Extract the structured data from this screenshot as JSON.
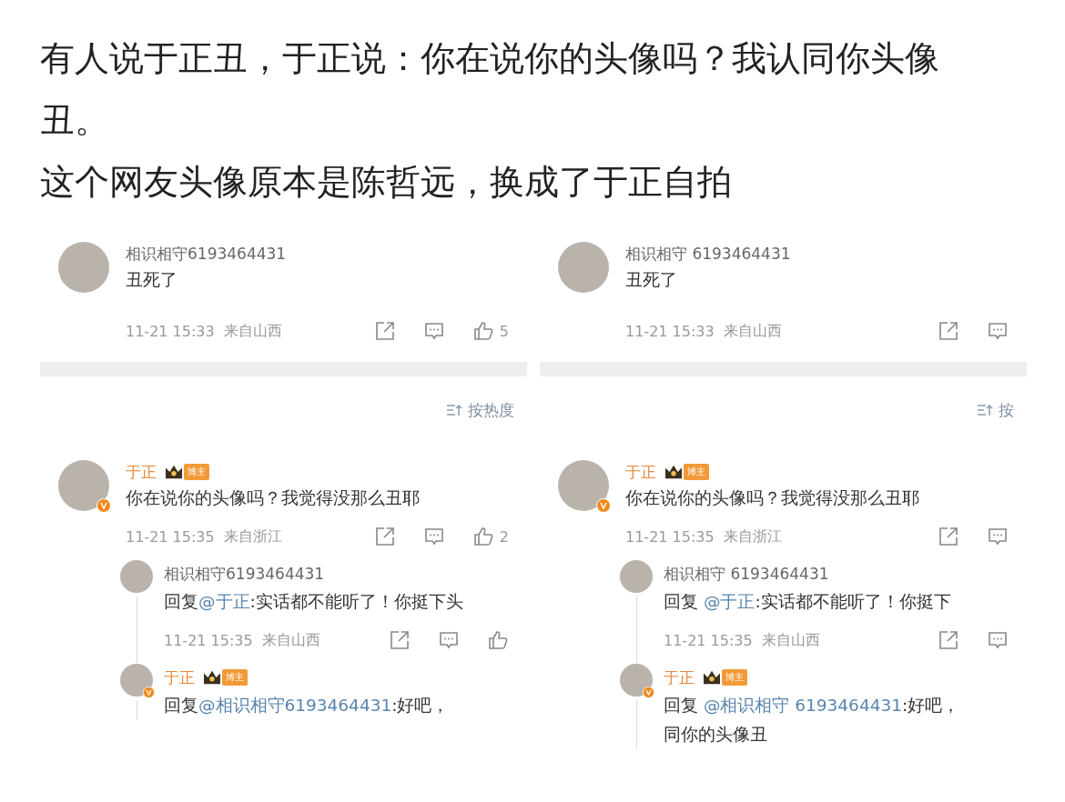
{
  "post": {
    "paragraphs": [
      "有人说于正丑，于正说：你在说你的头像吗？我认同你头像丑。",
      "这个网友头像原本是陈哲远，换成了于正自拍"
    ]
  },
  "screenshots": [
    {
      "top_comment": {
        "user": "相识相守6193464431",
        "verified": false,
        "text": "丑死了",
        "time": "11-21 15:33",
        "location": "来自山西",
        "likes": "5",
        "like_icon": true
      },
      "sort_label": "按热度",
      "comment": {
        "user": "于正",
        "badge": "博主",
        "verified": true,
        "text": "你在说你的头像吗？我觉得没那么丑耶",
        "time": "11-21 15:35",
        "location": "来自浙江",
        "likes": "2",
        "like_icon": true,
        "children": [
          {
            "user": "相识相守6193464431",
            "verified": false,
            "reply_prefix": "回复",
            "mention": "@于正",
            "text": ":实话都不能听了！你挺下头",
            "time": "11-21 15:35",
            "location": "来自山西",
            "like_icon": true
          },
          {
            "user": "于正",
            "badge": "博主",
            "verified": true,
            "reply_prefix": "回复",
            "mention": "@相识相守6193464431",
            "text": ":好吧，"
          }
        ]
      }
    },
    {
      "top_comment": {
        "user": "相识相守 6193464431",
        "verified": false,
        "text": "丑死了",
        "time": "11-21 15:33",
        "location": "来自山西",
        "like_icon": false
      },
      "sort_label": "按",
      "comment": {
        "user": "于正",
        "badge": "博主",
        "verified": true,
        "text": "你在说你的头像吗？我觉得没那么丑耶",
        "time": "11-21 15:35",
        "location": "来自浙江",
        "like_icon": false,
        "children": [
          {
            "user": "相识相守 6193464431",
            "verified": false,
            "reply_prefix": "回复 ",
            "mention": "@于正",
            "text": ":实话都不能听了！你挺下",
            "time": "11-21 15:35",
            "location": "来自山西",
            "like_icon": false
          },
          {
            "user": "于正",
            "badge": "博主",
            "verified": true,
            "reply_prefix": "回复 ",
            "mention": "@相识相守 6193464431",
            "text": ":好吧，",
            "continuation": "同你的头像丑"
          }
        ]
      }
    }
  ]
}
